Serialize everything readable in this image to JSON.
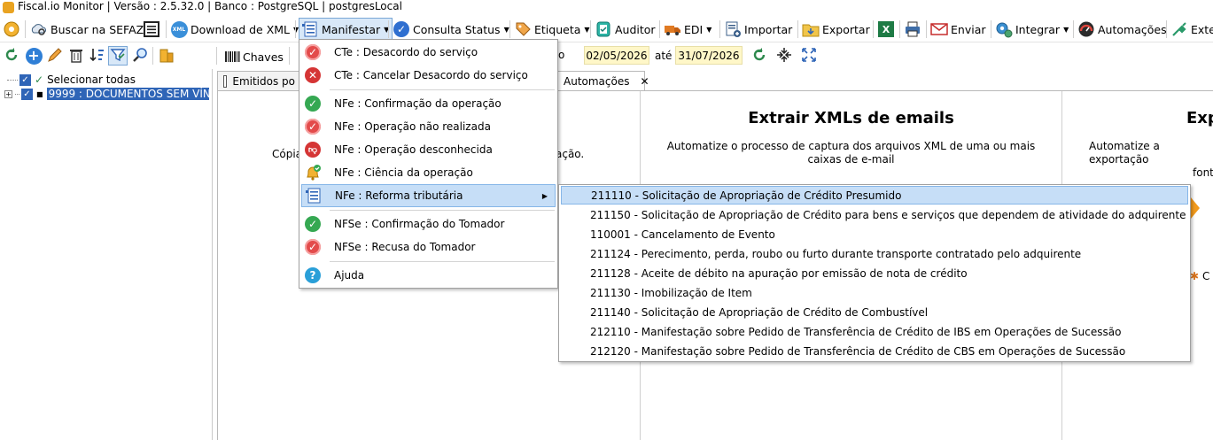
{
  "window": {
    "title": "Fiscal.io Monitor | Versão : 2.5.32.0 | Banco : PostgreSQL | postgresLocal"
  },
  "toolbar": {
    "buscar_sefaz": "Buscar na SEFAZ",
    "download_xml": "Download de XML",
    "manifestar": "Manifestar",
    "consulta_status": "Consulta Status",
    "etiqueta": "Etiqueta",
    "auditor": "Auditor",
    "edi": "EDI",
    "importar": "Importar",
    "exportar": "Exportar",
    "enviar": "Enviar",
    "integrar": "Integrar",
    "automacoes": "Automações",
    "extensoes": "Exte"
  },
  "filter": {
    "chaves": "Chaves",
    "date_from": "02/05/2026",
    "ate": "até",
    "date_to": "31/07/2026",
    "fragment": "o"
  },
  "tree": {
    "select_all": "Selecionar todas",
    "company": "9999 : DOCUMENTOS SEM VÍNC"
  },
  "tabs": {
    "emitidos": "Emitidos po",
    "automacoes": "Automações",
    "close": "✕"
  },
  "cards": {
    "left_text": "Cópia",
    "left_text2": "ação.",
    "middle_title": "Extrair XMLs de emails",
    "middle_desc": "Automatize o processo de captura dos arquivos XML de uma ou mais caixas de e-mail",
    "right_title": "Exp",
    "right_desc": "Automatize a exportação",
    "right_desc2": "font",
    "right_fragment": "C"
  },
  "menu": {
    "items": [
      {
        "label": "CTe : Desacordo do serviço",
        "icon": "check-red-icon"
      },
      {
        "label": "CTe : Cancelar Desacordo do serviço",
        "icon": "cancel-x-icon"
      },
      {
        "label": "NFe : Confirmação da operação",
        "icon": "check-green-icon"
      },
      {
        "label": "NFe : Operação não realizada",
        "icon": "check-red-icon"
      },
      {
        "label": "NFe : Operação desconhecida",
        "icon": "thumbs-down-icon"
      },
      {
        "label": "NFe : Ciência da operação",
        "icon": "bell-check-icon"
      },
      {
        "label": "NFe : Reforma tributária",
        "icon": "document-list-icon"
      },
      {
        "label": "NFSe : Confirmação do Tomador",
        "icon": "check-green-icon"
      },
      {
        "label": "NFSe : Recusa do Tomador",
        "icon": "check-red-icon"
      },
      {
        "label": "Ajuda",
        "icon": "help-icon"
      }
    ]
  },
  "submenu": {
    "items": [
      "211110 - Solicitação de Apropriação de Crédito Presumido",
      "211150 - Solicitação de Apropriação de Crédito para bens e serviços que dependem de atividade do adquirente",
      "110001 - Cancelamento de Evento",
      "211124 - Perecimento, perda, roubo ou furto durante transporte contratado pelo adquirente",
      "211128 - Aceite de débito na apuração por emissão de nota de crédito",
      "211130 - Imobilização de Item",
      "211140 - Solicitação de Apropriação de Crédito de Combustível",
      "212110 - Manifestação sobre Pedido de Transferência de Crédito de IBS em Operações de Sucessão",
      "212120 - Manifestação sobre Pedido de Transferência de Crédito de CBS em Operações de Sucessão"
    ]
  },
  "colors": {
    "highlight": "#c6def7",
    "accent_blue": "#2f65b7",
    "date_bg": "#fff7c8"
  }
}
